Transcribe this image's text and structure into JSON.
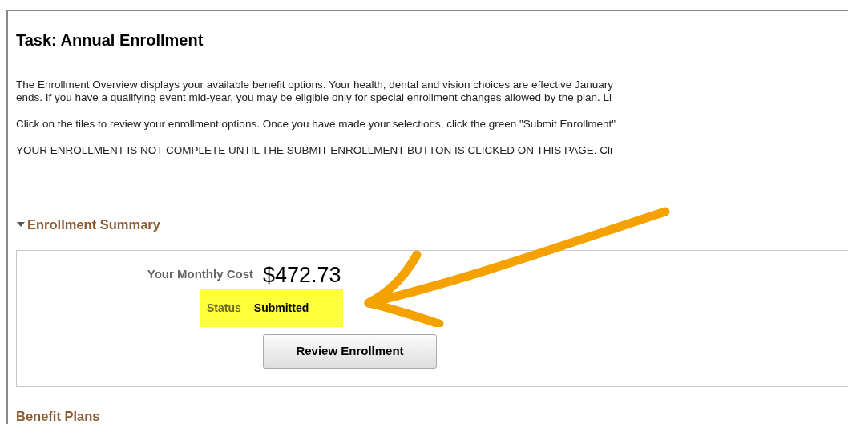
{
  "task": {
    "title": "Task: Annual Enrollment"
  },
  "paragraphs": [
    "The Enrollment Overview displays your available benefit options. Your health, dental and vision choices are effective January\nends. If you have a qualifying event mid-year, you may be eligible only for special enrollment changes allowed by the plan. Li",
    "Click on the tiles to review your enrollment options. Once you have made your selections, click the green \"Submit Enrollment\"",
    "YOUR ENROLLMENT IS NOT COMPLETE UNTIL THE SUBMIT ENROLLMENT BUTTON IS CLICKED ON THIS PAGE. Cli"
  ],
  "summary": {
    "heading": "Enrollment Summary",
    "expanded": true,
    "cost_label": "Your Monthly Cost",
    "cost": "$472.73",
    "status_label": "Status",
    "status": "Submitted",
    "status_highlighted": true,
    "button": "Review Enrollment"
  },
  "annotations": [
    {
      "kind": "arrow"
    }
  ],
  "benefit_plans": {
    "heading": "Benefit Plans"
  }
}
